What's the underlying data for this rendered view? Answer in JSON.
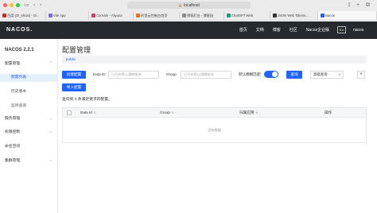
{
  "browser": {
    "address": "localhost",
    "tabs": [
      {
        "label": "百度 (zh_shuai) - Gi...",
        "color": "#e02020",
        "active": false
      },
      {
        "label": "Vite App",
        "color": "#7b68ee",
        "active": false
      },
      {
        "label": "Console - Aliyuna",
        "color": "#d6376b",
        "active": false
      },
      {
        "label": "阿里云控制台首页",
        "color": "#ff6a00",
        "active": false
      },
      {
        "label": "博客后台 - 博客园",
        "color": "#8a8a8a",
        "active": false
      },
      {
        "label": "ChatGPT Web",
        "color": "#10a37f",
        "active": false
      },
      {
        "label": "JSON Web Tokens...",
        "color": "#333333",
        "active": false
      },
      {
        "label": "Nacos",
        "color": "#1f63ff",
        "active": true
      }
    ]
  },
  "topnav": {
    "logo": "NACOS.",
    "links": [
      "首页",
      "文档",
      "博客",
      "社区",
      "Nacos企业版"
    ],
    "lang": "En",
    "user": "nacos"
  },
  "sidebar": {
    "version": "NACOS 2.2.1",
    "config_group": "配置管理",
    "config_items": [
      "配置列表",
      "历史版本",
      "监听查询"
    ],
    "service_group": "服务管理",
    "auth_group": "权限控制",
    "namespace": "命名空间",
    "cluster_group": "集群管理"
  },
  "main": {
    "title": "配置管理",
    "namespace_tag": "public",
    "create_button": "创建配置",
    "dataid_label": "Data ID",
    "dataid_placeholder": "已开启默认模糊查询",
    "group_label": "Group",
    "group_placeholder": "已开启默认模糊查询",
    "fuzzy_label": "默认模糊匹配",
    "query_button": "查询",
    "advanced_select": "高级查询",
    "import_button": "导入配置",
    "result_text": "查询到 0 条满足要求的配置。",
    "columns": [
      "Data Id",
      "Group",
      "归属应用",
      "操作"
    ],
    "empty_text": "没有数据"
  },
  "colors": {
    "accent": "#1f63ff",
    "nav_bg": "#252a2f"
  }
}
